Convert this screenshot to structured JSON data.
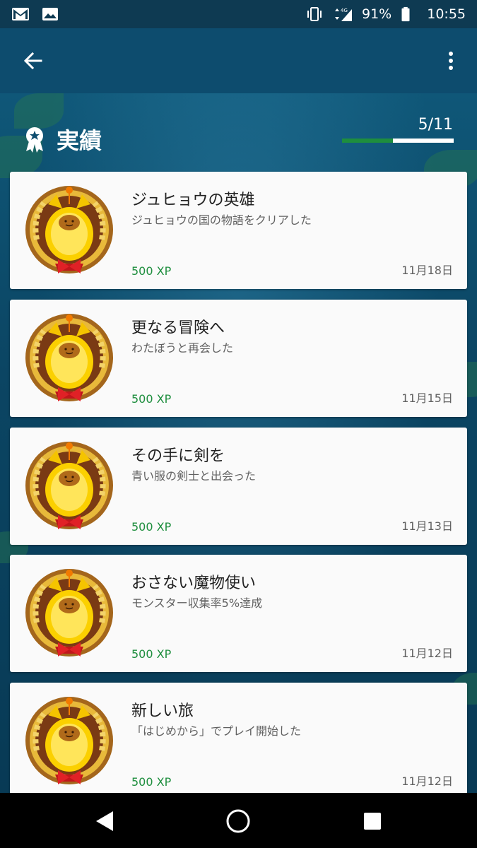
{
  "status_bar": {
    "left_icons": [
      "gmail-icon",
      "image-icon"
    ],
    "right_icons": [
      "vibrate-icon",
      "4g-signal-icon",
      "battery-icon"
    ],
    "network": "4G",
    "battery": "91%",
    "time": "10:55"
  },
  "app_bar": {
    "back_icon": "arrow-back-icon",
    "menu_icon": "more-vert-icon"
  },
  "header": {
    "title": "実績",
    "icon": "achievement-ribbon-icon",
    "progress_text": "5/11",
    "progress_fraction": 0.4545
  },
  "achievements": [
    {
      "title": "ジュヒョウの英雄",
      "description": "ジュヒョウの国の物語をクリアした",
      "xp": "500 XP",
      "date": "11月18日"
    },
    {
      "title": "更なる冒険へ",
      "description": "わたぼうと再会した",
      "xp": "500 XP",
      "date": "11月15日"
    },
    {
      "title": "その手に剣を",
      "description": "青い服の剣士と出会った",
      "xp": "500 XP",
      "date": "11月13日"
    },
    {
      "title": "おさない魔物使い",
      "description": "モンスター収集率5%達成",
      "xp": "500 XP",
      "date": "11月12日"
    },
    {
      "title": "新しい旅",
      "description": "「はじめから」でプレイ開始した",
      "xp": "500 XP",
      "date": "11月12日"
    }
  ],
  "colors": {
    "app_bar": "#0d4c6e",
    "accent_green": "#1e8e3e",
    "card_bg": "#fafafa"
  },
  "nav_bar": {
    "icons": [
      "back-triangle-icon",
      "home-circle-icon",
      "recents-square-icon"
    ]
  }
}
